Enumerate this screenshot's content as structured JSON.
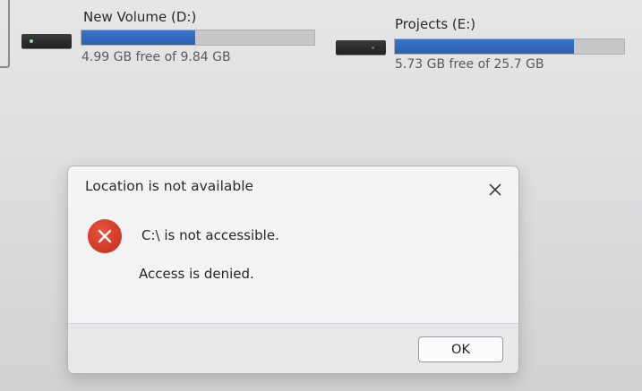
{
  "drives": [
    {
      "name": "New Volume (D:)",
      "info": "4.99 GB free of 9.84 GB",
      "used_fraction": 0.49
    },
    {
      "name": "Projects (E:)",
      "info": "5.73 GB free of 25.7 GB",
      "used_fraction": 0.78
    }
  ],
  "dialog": {
    "title": "Location is not available",
    "message_line1": "C:\\ is not accessible.",
    "message_line2": "Access is denied.",
    "ok_label": "OK",
    "icon": "error-icon",
    "close_icon": "close-icon"
  },
  "colors": {
    "bar_fill": "#2f66ba",
    "bar_track": "#c7c7c9",
    "error_red": "#d33b26"
  }
}
